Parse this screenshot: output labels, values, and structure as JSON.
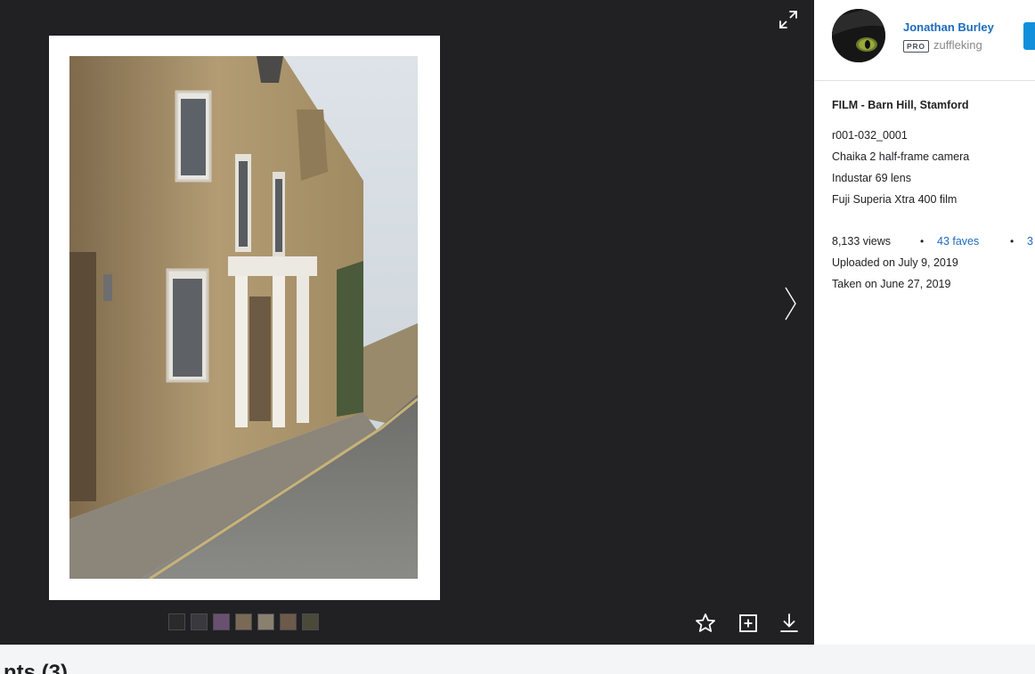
{
  "viewer": {
    "photo_alt": "FILM - Barn Hill, Stamford",
    "thumbnails": [
      {
        "color": "#2a2a2a"
      },
      {
        "color": "#3a3a3e"
      },
      {
        "color": "#6a5070"
      },
      {
        "color": "#7a6a55"
      },
      {
        "color": "#8a8070"
      },
      {
        "color": "#6e5a4a"
      },
      {
        "color": "#4a4a3a"
      }
    ],
    "icons": {
      "fullscreen": "expand-icon",
      "next": "chevron-right-icon",
      "fave": "star-icon",
      "add_to_gallery": "plus-square-icon",
      "download": "download-icon"
    }
  },
  "sidebar": {
    "author_name": "Jonathan Burley",
    "pro_badge": "PRO",
    "username": "zuffleking",
    "photo_title": "FILM - Barn Hill, Stamford",
    "description_lines": [
      "r001-032_0001",
      "Chaika 2 half-frame camera",
      "Industar 69 lens",
      "Fuji Superia Xtra 400 film"
    ],
    "stats": {
      "views": "8,133 views",
      "bullet": "•",
      "faves": "43 faves",
      "comments_count": "3",
      "uploaded": "Uploaded on July 9, 2019",
      "taken": "Taken on June 27, 2019"
    }
  },
  "bottom": {
    "comments_heading": "nts (3)"
  },
  "colors": {
    "viewer_bg": "#212124",
    "accent_link": "#1c6bbd",
    "follow_button": "#128fdc",
    "bottom_bg": "#f3f5f6"
  }
}
